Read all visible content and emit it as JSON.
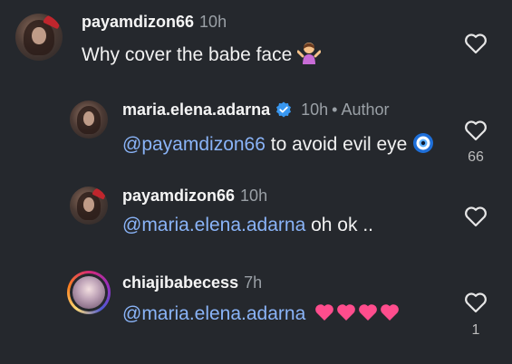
{
  "comments": [
    {
      "username": "payamdizon66",
      "time": "10h",
      "text": "Why cover the babe face",
      "emoji": "shrugging-woman-emoji",
      "likes": ""
    },
    {
      "username": "maria.elena.adarna",
      "time": "10h",
      "separator": "•",
      "author_label": "Author",
      "mention": "@payamdizon66",
      "text": " to avoid evil eye",
      "emoji": "nazar-amulet-emoji",
      "likes": "66"
    },
    {
      "username": "payamdizon66",
      "time": "10h",
      "mention": "@maria.elena.adarna",
      "text": " oh ok ..",
      "likes": ""
    },
    {
      "username": "chiajibabecess",
      "time": "7h",
      "mention": "@maria.elena.adarna",
      "text": "",
      "emoji": "pink-hearts-emoji",
      "likes": "1"
    }
  ],
  "colors": {
    "background": "#25282d",
    "mention": "#8ab4f8",
    "verified": "#3897f0",
    "heart_emoji": "#ff4d8d"
  }
}
